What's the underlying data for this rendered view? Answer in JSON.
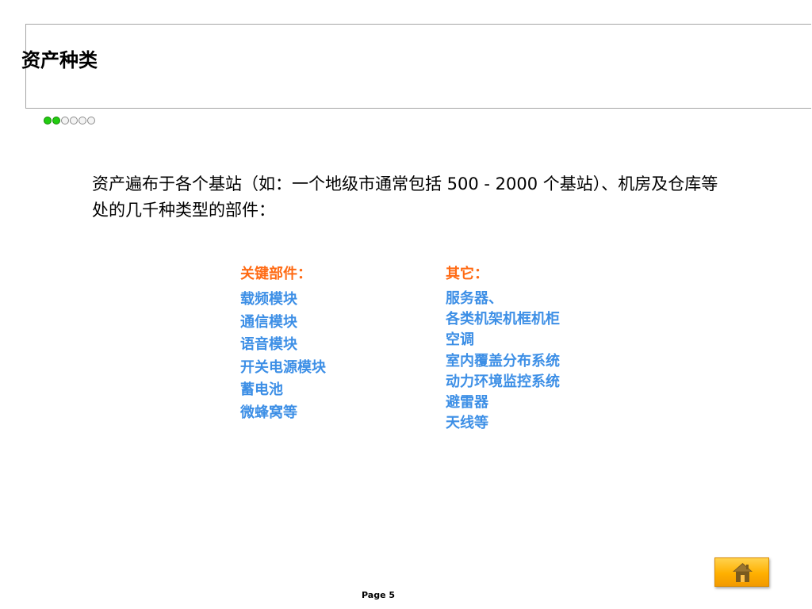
{
  "slide": {
    "title": "资产种类",
    "progress": {
      "total": 6,
      "current": 2
    },
    "intro": "资产遍布于各个基站（如：一个地级市通常包括 500  -  2000 个基站）、机房及仓库等处的几千种类型的部件：",
    "key_parts": {
      "heading": "关键部件：",
      "items": [
        "载频模块",
        "通信模块",
        "语音模块",
        "开关电源模块",
        "蓄电池",
        "微蜂窝等"
      ]
    },
    "others": {
      "heading": "其它：",
      "items": [
        "服务器、",
        "各类机架机框机柜",
        "空调",
        "室内覆盖分布系统",
        "动力环境监控系统",
        "避雷器",
        "天线等"
      ]
    },
    "page_label": "Page 5",
    "home_icon": "home-icon",
    "colors": {
      "heading_accent": "#ff6a13",
      "list_text": "#3d8fe6",
      "progress_active": "#22cc11",
      "home_button": "#ffb000"
    }
  }
}
